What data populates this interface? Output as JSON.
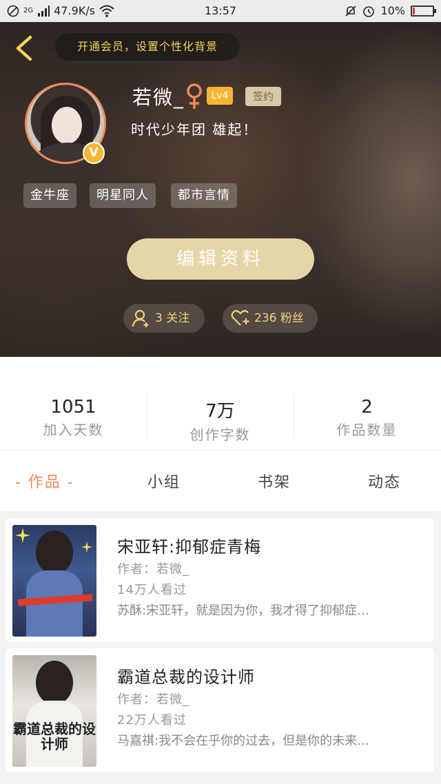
{
  "status_bar": {
    "network": "2G",
    "speed": "47.9K/s",
    "time": "13:57",
    "battery": "10%",
    "battery_level": 0.1,
    "battery_color": "#e53935"
  },
  "header": {
    "vip_banner": "开通会员，设置个性化背景",
    "username": "若微_",
    "level": "Lv4",
    "sign_badge": "签约",
    "signature": "时代少年团 雄起！",
    "verified_badge": "V",
    "tags": [
      "金牛座",
      "明星同人",
      "都市言情"
    ],
    "edit_button": "编辑资料",
    "following": "3 关注",
    "followers": "236 粉丝"
  },
  "stats": [
    {
      "value": "1051",
      "label": "加入天数"
    },
    {
      "value": "7万",
      "label": "创作字数"
    },
    {
      "value": "2",
      "label": "作品数量"
    }
  ],
  "tabs": {
    "active": "- 作品 -",
    "group": "小组",
    "bookshelf": "书架",
    "activity": "动态"
  },
  "works": [
    {
      "title": "宋亚轩:抑郁症青梅",
      "author": "作者：若微_",
      "views": "14万人看过",
      "desc": "苏酥:宋亚轩，就是因为你，我才得了抑郁症…"
    },
    {
      "title": "霸道总裁的设计师",
      "author": "作者：若微_",
      "views": "22万人看过",
      "desc": "马嘉祺:我不会在乎你的过去，但是你的未来…",
      "cover_text": "霸道总裁的设计师"
    }
  ],
  "colors": {
    "accent": "#f08a5a",
    "gold": "#f6b530",
    "button": "#e6d5a8",
    "banner_text": "#f3d259"
  }
}
